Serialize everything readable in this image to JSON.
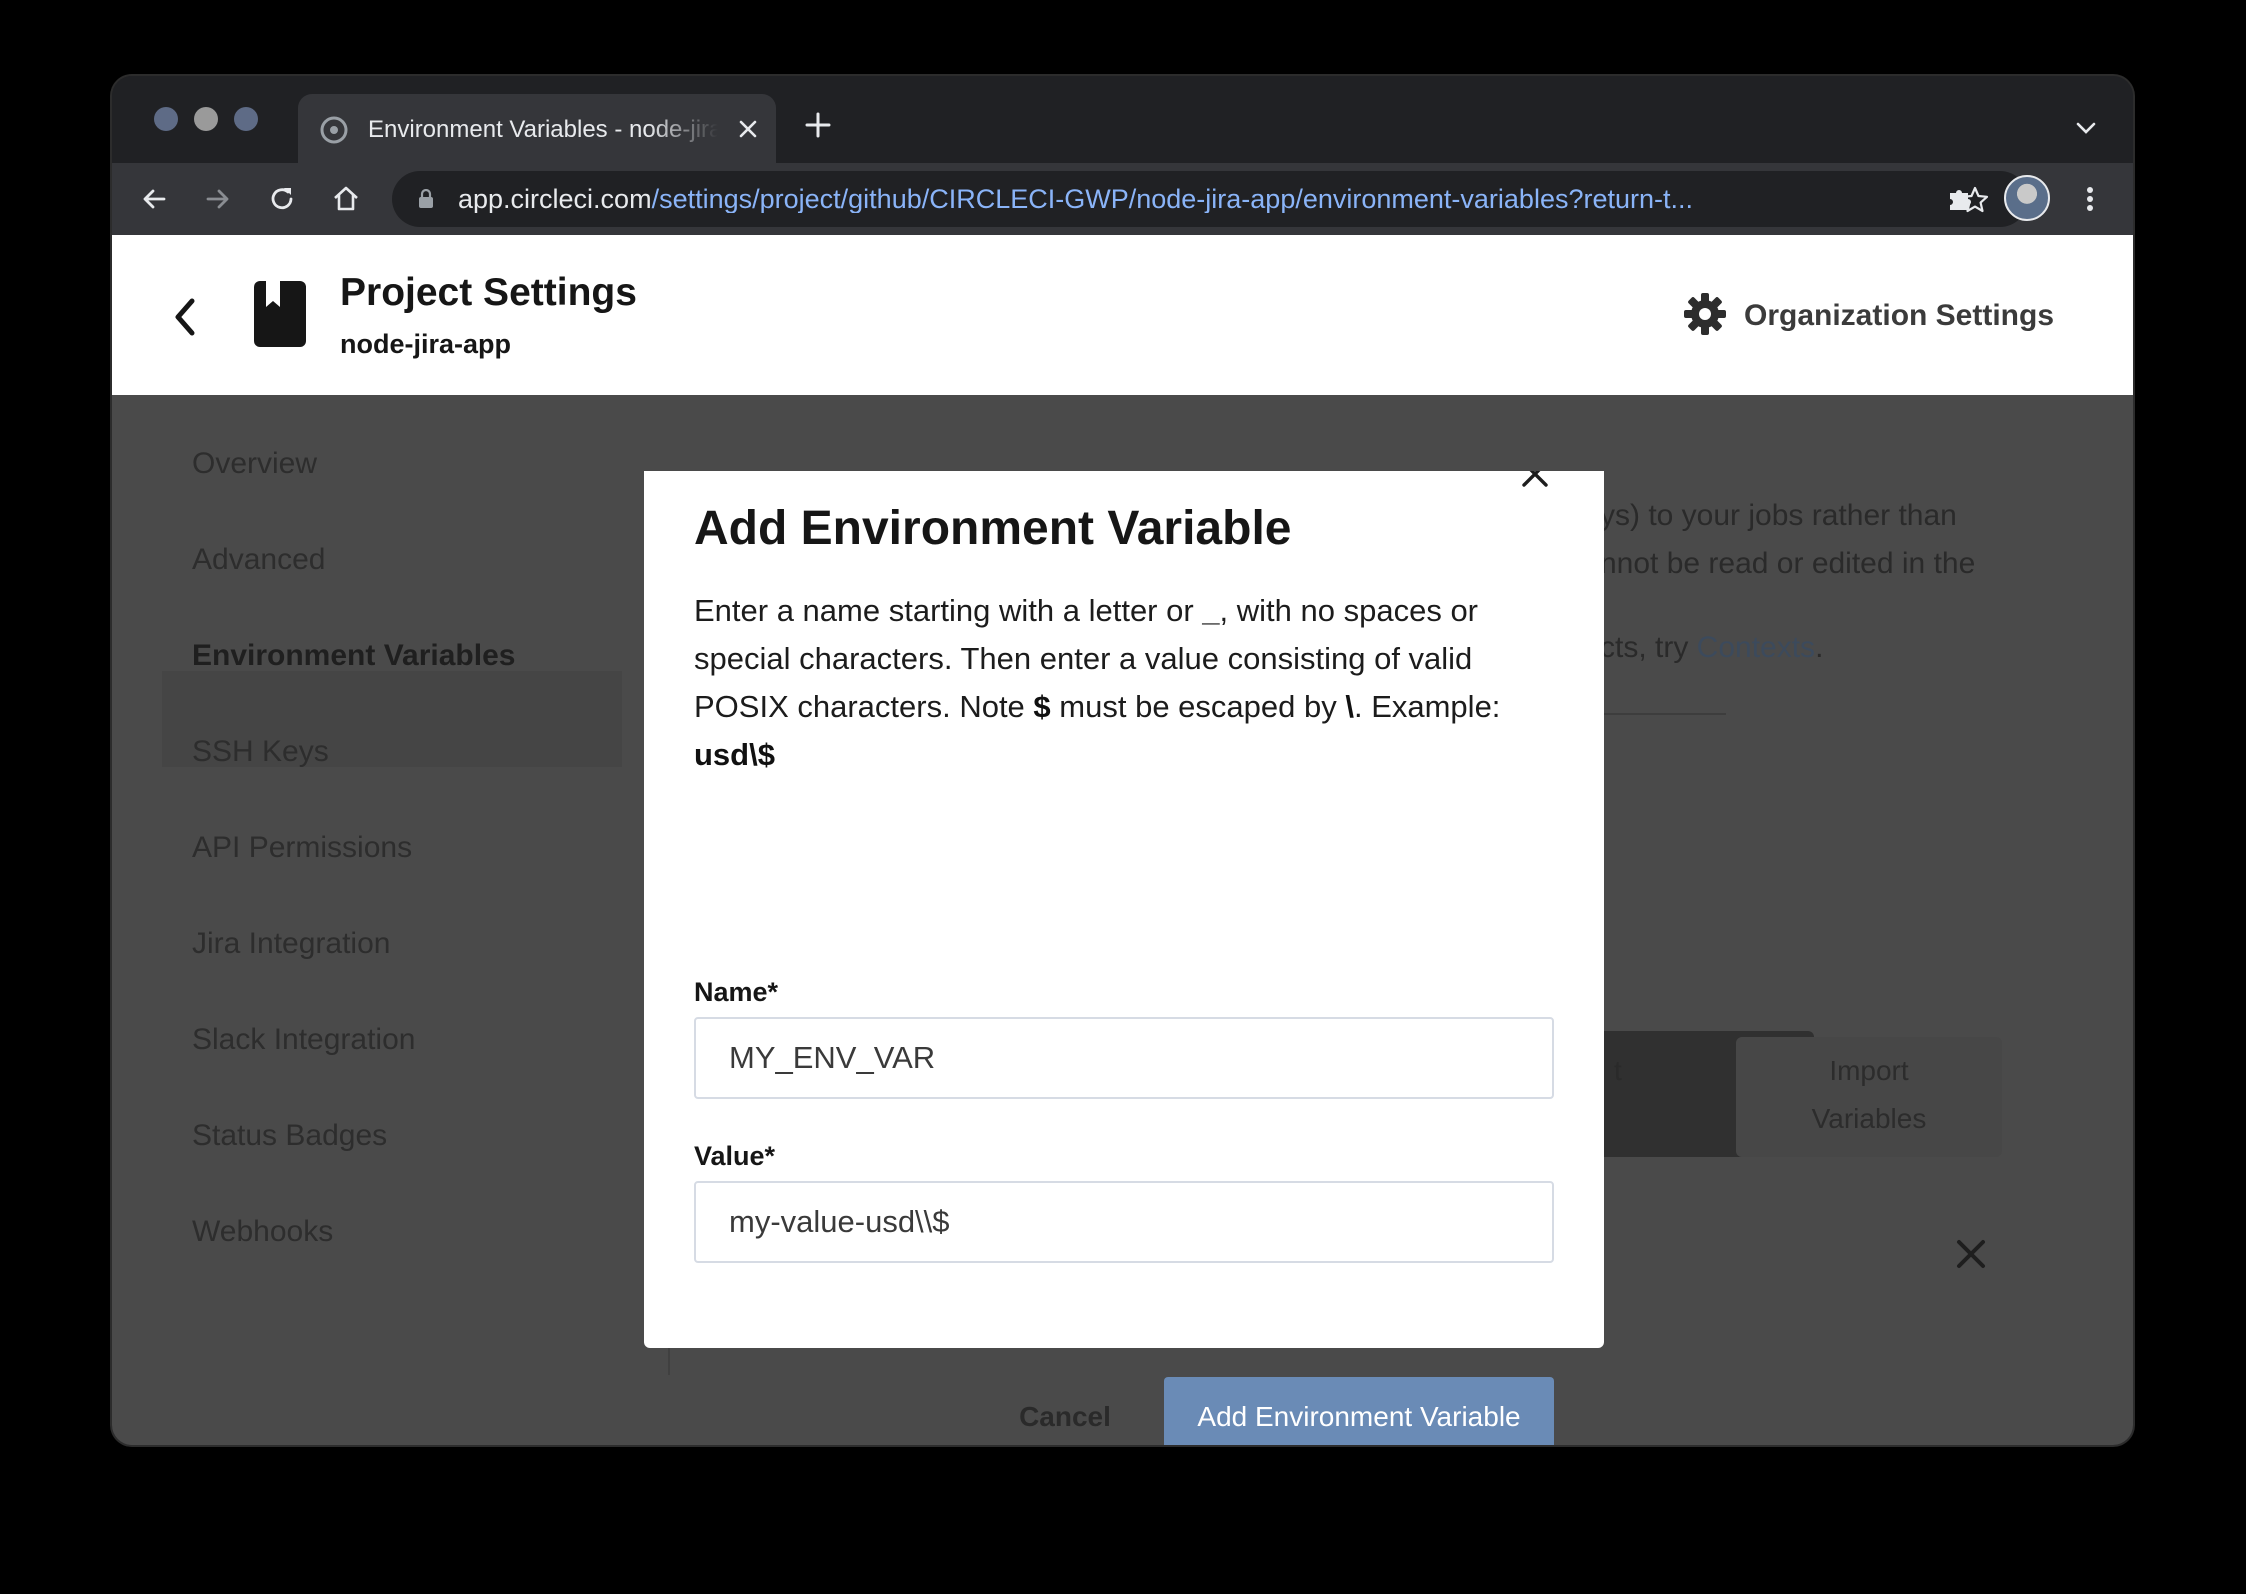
{
  "browser": {
    "tab_title": "Environment Variables - node-jira-app",
    "url_host": "app.circleci.com",
    "url_path": "/settings/project/github/CIRCLECI-GWP/node-jira-app/environment-variables?return-t..."
  },
  "header": {
    "title": "Project Settings",
    "subtitle": "node-jira-app",
    "org_settings_label": "Organization Settings"
  },
  "sidebar": {
    "items": [
      {
        "label": "Overview"
      },
      {
        "label": "Advanced"
      },
      {
        "label": "Environment Variables"
      },
      {
        "label": "SSH Keys"
      },
      {
        "label": "API Permissions"
      },
      {
        "label": "Jira Integration"
      },
      {
        "label": "Slack Integration"
      },
      {
        "label": "Status Badges"
      },
      {
        "label": "Webhooks"
      }
    ],
    "active_index": 2
  },
  "background": {
    "line1": "ys) to your jobs rather than",
    "line2": "nnot be read or edited in the",
    "line3_prefix": "cts, try ",
    "line3_link": "Contexts",
    "line3_suffix": ".",
    "add_button_fragment": "t",
    "import_button_line1": "Import",
    "import_button_line2": "Variables"
  },
  "modal": {
    "title": "Add Environment Variable",
    "desc_part1": "Enter a name starting with a letter or ",
    "desc_underscore": "_",
    "desc_part2": ", with no spaces or special characters. Then enter a value consisting of valid POSIX characters. Note ",
    "desc_dollar": "$",
    "desc_part3": " must be escaped by ",
    "desc_backslash": "\\",
    "desc_part4": ". Example: ",
    "desc_example": "usd\\$",
    "name_label": "Name*",
    "name_value": "MY_ENV_VAR",
    "value_label": "Value*",
    "value_value": "my-value-usd\\\\$",
    "cancel_label": "Cancel",
    "submit_label": "Add Environment Variable"
  },
  "colors": {
    "primary_button": "#6a8bb6",
    "url_path": "#8ab4f8",
    "overlay": "#4a4a4a"
  },
  "icons": {
    "back": "back-arrow-icon",
    "forward": "forward-arrow-icon",
    "reload": "reload-icon",
    "home": "home-icon",
    "lock": "lock-icon",
    "star": "bookmark-star-icon",
    "extensions": "puzzle-icon",
    "menu": "kebab-menu-icon",
    "project": "bookmark-book-icon",
    "gear": "gear-icon",
    "close": "close-icon"
  }
}
